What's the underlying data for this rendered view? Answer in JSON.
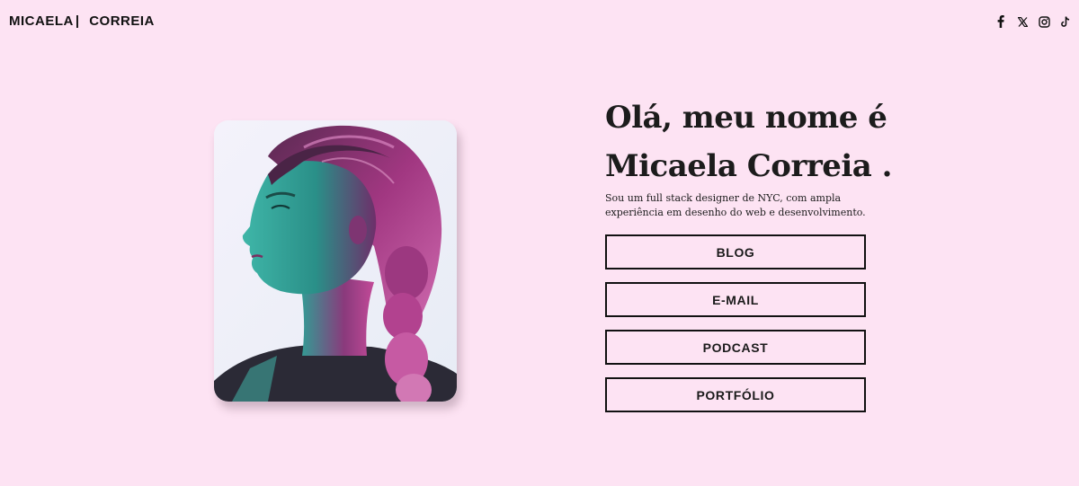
{
  "header": {
    "brand_first": "MICAELA",
    "brand_separator": "|",
    "brand_last": "CORREIA",
    "social_icons": [
      "facebook-icon",
      "x-icon",
      "instagram-icon",
      "tiktok-icon"
    ]
  },
  "hero": {
    "portrait_icon": "woman-profile-portrait",
    "headline_line1": "Olá, meu nome é",
    "headline_line2": "Micaela Correia .",
    "bio": "Sou um full stack designer de NYC, com ampla experiência em desenho do web e desenvolvimento.",
    "buttons": [
      {
        "label": "BLOG"
      },
      {
        "label": "E-MAIL"
      },
      {
        "label": "PODCAST"
      },
      {
        "label": "PORTFÓLIO"
      }
    ]
  },
  "colors": {
    "background": "#fde3f3",
    "text": "#1a1a1a",
    "portrait_teal": "#2aa59b",
    "portrait_magenta": "#b2378a"
  }
}
